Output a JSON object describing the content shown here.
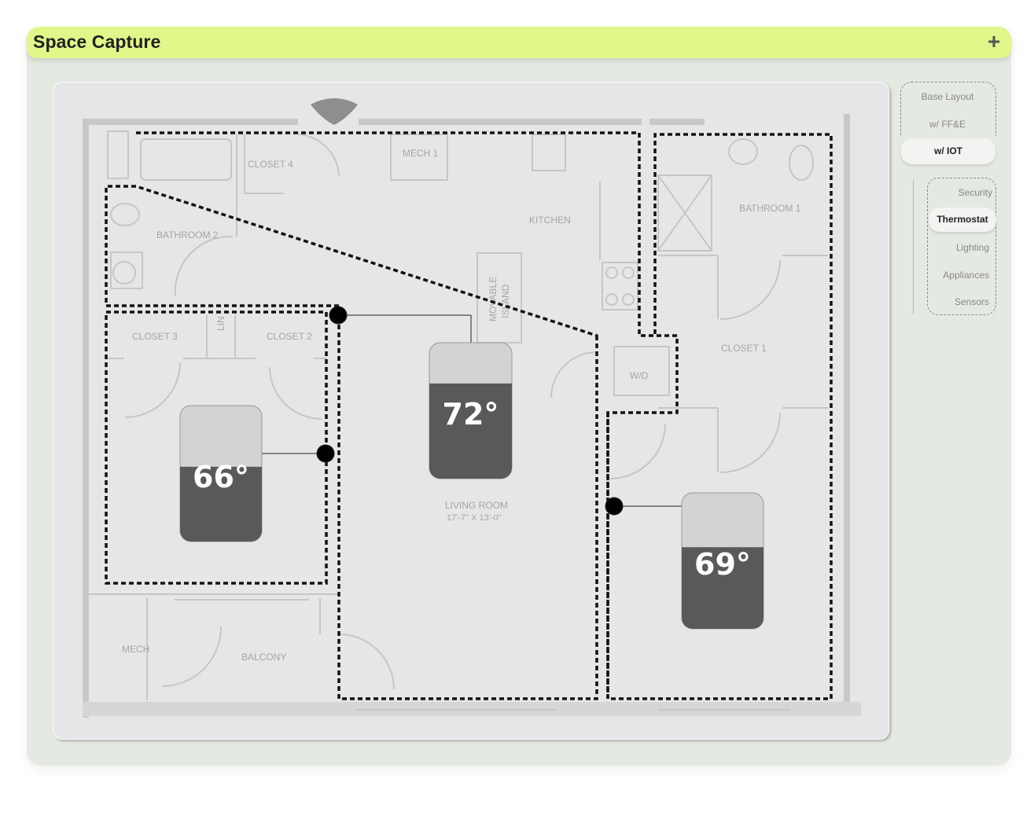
{
  "app": {
    "title": "Space Capture",
    "add_icon": "plus-icon"
  },
  "view_menu": {
    "items": [
      "Base Layout",
      "w/ FF&E",
      "w/ IOT"
    ],
    "active": "w/ IOT"
  },
  "iot_menu": {
    "items": [
      "Security",
      "Thermostat",
      "Lighting",
      "Appliances",
      "Sensors"
    ],
    "active": "Thermostat"
  },
  "rooms": {
    "bathroom2": "BATHROOM 2",
    "closet4": "CLOSET 4",
    "mech1": "MECH 1",
    "kitchen": "KITCHEN",
    "island_line1": "MOVABLE",
    "island_line2": "ISLAND",
    "bathroom1": "BATHROOM 1",
    "closet3": "CLOSET 3",
    "lin": "LIN",
    "closet2": "CLOSET 2",
    "closet1": "CLOSET 1",
    "wd": "W/D",
    "living": "LIVING ROOM",
    "living_dims": "17'-7\" X 13'-0\"",
    "mech": "MECH",
    "balcony": "BALCONY"
  },
  "thermostats": [
    {
      "zone": "left-bedroom",
      "temp": "66°",
      "level": 0.55
    },
    {
      "zone": "living-room",
      "temp": "72°",
      "level": 0.7
    },
    {
      "zone": "right-bedroom",
      "temp": "69°",
      "level": 0.6
    }
  ],
  "colors": {
    "accent": "#e0f78a",
    "panel": "#e4e9e2",
    "thermo_fill": "#58595b",
    "thermo_empty": "#d3d3d5"
  }
}
